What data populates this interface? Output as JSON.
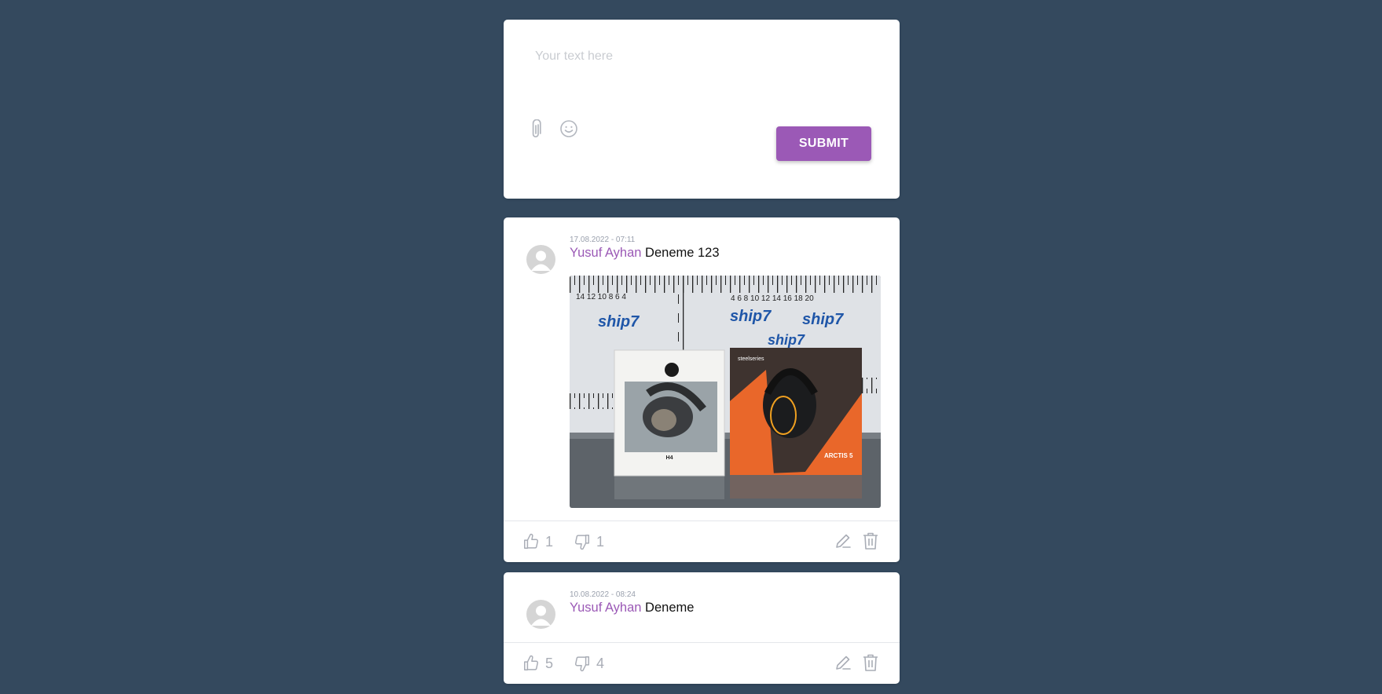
{
  "composer": {
    "placeholder": "Your text here",
    "attach_icon": "paperclip-icon",
    "emoji_icon": "smiley-icon",
    "submit_label": "SUBMIT"
  },
  "posts": [
    {
      "timestamp": "17.08.2022 - 07:11",
      "author": "Yusuf Ayhan",
      "text": "Deneme 123",
      "likes": "1",
      "dislikes": "1",
      "has_image": true
    },
    {
      "timestamp": "10.08.2022 - 08:24",
      "author": "Yusuf Ayhan",
      "text": "Deneme",
      "likes": "5",
      "dislikes": "4",
      "has_image": false
    }
  ],
  "image_labels": {
    "brand": "ship7",
    "box_left_model": "H4",
    "box_right_brand": "steelseries",
    "box_right_model": "ARCTIS 5"
  },
  "colors": {
    "background": "#34495e",
    "accent": "#9b59b6",
    "icon_gray": "#a9adb6"
  }
}
